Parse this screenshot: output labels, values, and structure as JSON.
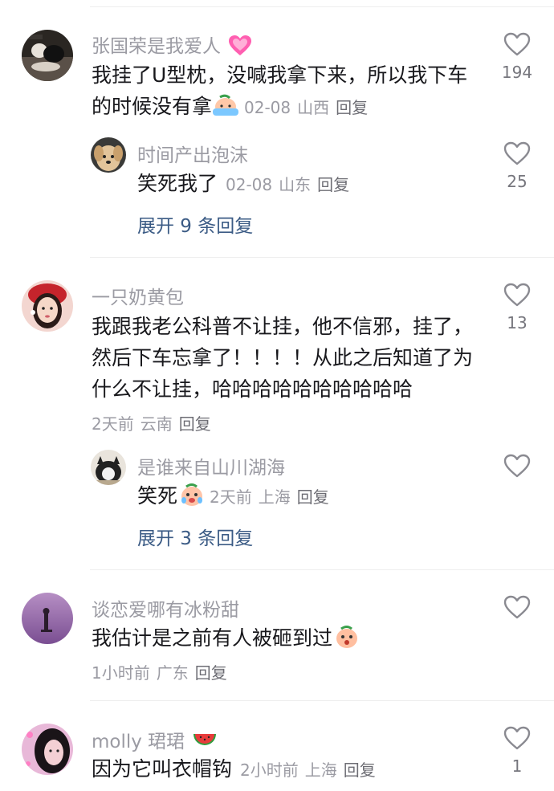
{
  "comments": [
    {
      "username": "张国荣是我爱人",
      "text_line1": "我挂了U型枕，没喊我拿下来，所以我下车",
      "text_line2": "的时候没有拿",
      "date": "02-08",
      "location": "山西",
      "reply_label": "回复",
      "likes": "194",
      "reply": {
        "username": "时间产出泡沫",
        "text": "笑死我了",
        "date": "02-08",
        "location": "山东",
        "reply_label": "回复",
        "likes": "25"
      },
      "expand_label": "展开 9 条回复"
    },
    {
      "username": "一只奶黄包",
      "text_line1": "我跟我老公科普不让挂，他不信邪，挂了，",
      "text_line2": "然后下车忘拿了！！！！从此之后知道了为",
      "text_line3": "什么不让挂，哈哈哈哈哈哈哈哈哈哈",
      "date": "2天前",
      "location": "云南",
      "reply_label": "回复",
      "likes": "13",
      "reply": {
        "username": "是谁来自山川湖海",
        "text": "笑死",
        "date": "2天前",
        "location": "上海",
        "reply_label": "回复"
      },
      "expand_label": "展开 3 条回复"
    },
    {
      "username": "谈恋爱哪有冰粉甜",
      "text_line1": "我估计是之前有人被砸到过",
      "date": "1小时前",
      "location": "广东",
      "reply_label": "回复"
    },
    {
      "username": "molly 珺珺",
      "text_line1": "因为它叫衣帽钩",
      "date": "2小时前",
      "location": "上海",
      "reply_label": "回复",
      "likes": "1"
    }
  ],
  "icons": {
    "like": "heart-outline-icon",
    "heart_emoji": "pink-heart-emoji",
    "watermelon_emoji": "watermelon-emoji",
    "peach_emoji": "peach-face-emoji"
  },
  "colors": {
    "username": "#9b9ba3",
    "text": "#18181c",
    "expand": "#3b5b85",
    "heart_icon": "#8a8a91"
  }
}
